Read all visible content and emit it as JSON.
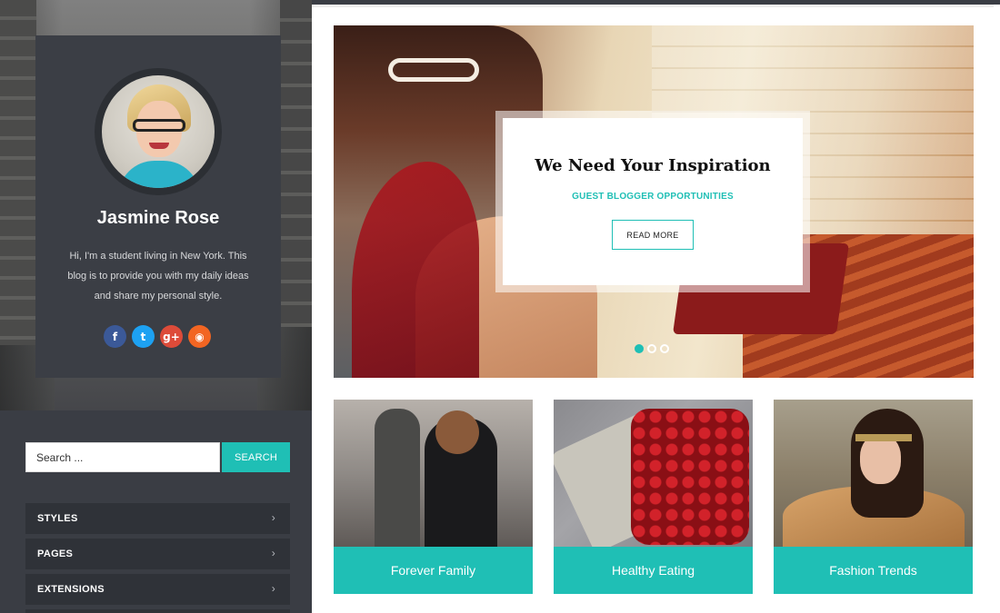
{
  "profile": {
    "name": "Jasmine Rose",
    "bio": "Hi, I'm a student living in New York. This blog is to provide you with my daily ideas and share my personal style.",
    "social": [
      {
        "icon": "facebook-icon",
        "glyph": "f",
        "color": "#3b5998"
      },
      {
        "icon": "twitter-icon",
        "glyph": "t",
        "color": "#1da1f2"
      },
      {
        "icon": "google-plus-icon",
        "glyph": "g+",
        "color": "#dd4b39"
      },
      {
        "icon": "rss-icon",
        "glyph": "◉",
        "color": "#f26522"
      }
    ]
  },
  "search": {
    "value": "Search ...",
    "button_label": "SEARCH"
  },
  "menu": {
    "items": [
      {
        "label": "STYLES"
      },
      {
        "label": "PAGES"
      },
      {
        "label": "EXTENSIONS"
      }
    ]
  },
  "hero": {
    "title": "We Need Your Inspiration",
    "subtitle": "GUEST BLOGGER OPPORTUNITIES",
    "button_label": "READ MORE",
    "slides": {
      "count": 3,
      "active": 1
    }
  },
  "tiles": [
    {
      "label": "Forever Family"
    },
    {
      "label": "Healthy Eating"
    },
    {
      "label": "Fashion Trends"
    }
  ],
  "colors": {
    "accent": "#1fbfb5",
    "sidebar": "#3a3d44",
    "card": "#3b3e45",
    "menu_item": "#2f3238"
  }
}
